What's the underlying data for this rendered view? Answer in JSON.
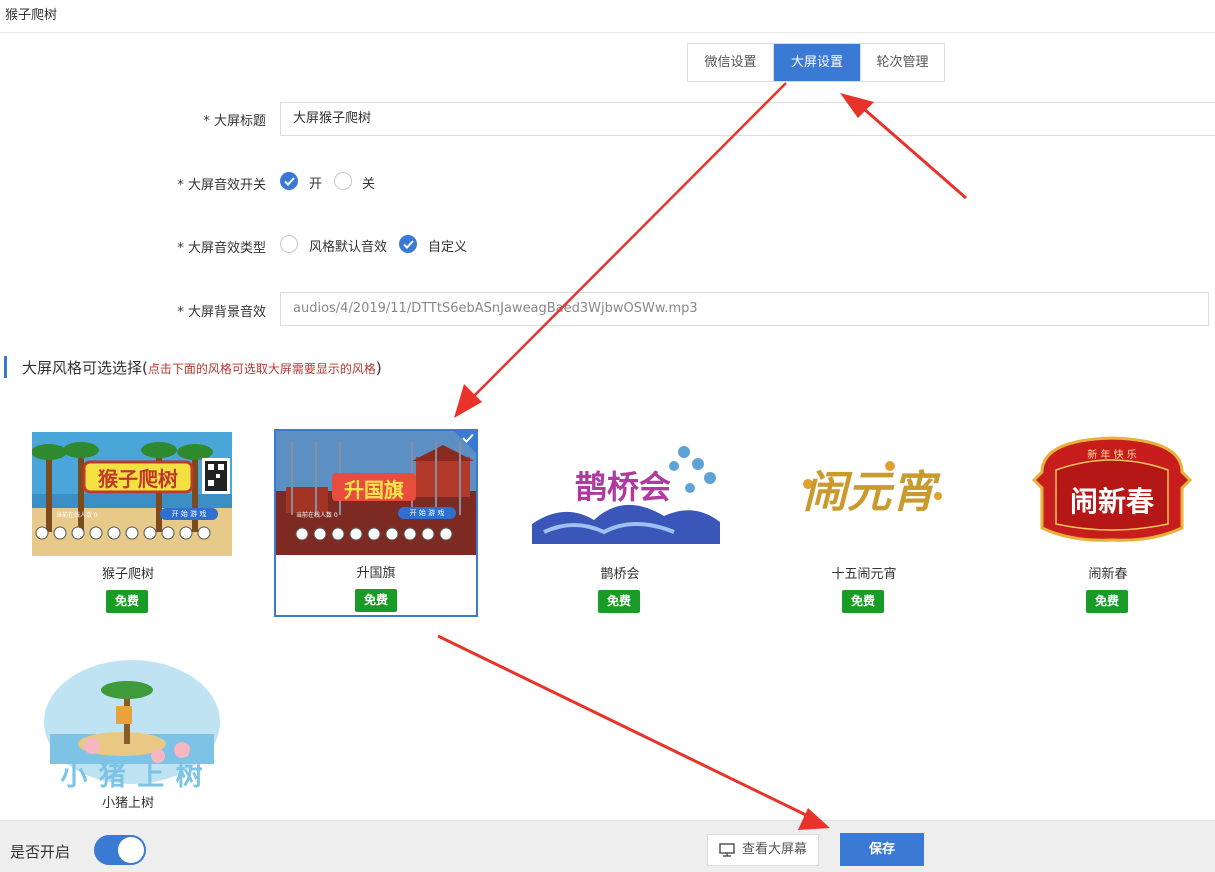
{
  "window": {
    "title": "猴子爬树"
  },
  "tabs": [
    {
      "label": "微信设置",
      "active": false
    },
    {
      "label": "大屏设置",
      "active": true
    },
    {
      "label": "轮次管理",
      "active": false
    }
  ],
  "form": {
    "screen_title": {
      "label": "* 大屏标题",
      "value": "大屏猴子爬树"
    },
    "sound_switch": {
      "label": "* 大屏音效开关",
      "on_label": "开",
      "off_label": "关",
      "selected": "开"
    },
    "sound_type": {
      "label": "* 大屏音效类型",
      "default_label": "风格默认音效",
      "custom_label": "自定义",
      "selected": "自定义"
    },
    "bg_sound": {
      "label": "* 大屏背景音效",
      "value": "audios/4/2019/11/DTTtS6ebASnJaweagBaed3WjbwOSWw.mp3"
    }
  },
  "styles_section": {
    "title": "大屏风格可选选择(",
    "hint": "点击下面的风格可选取大屏需要显示的风格",
    "title_end": ")"
  },
  "styles": [
    {
      "name": "猴子爬树",
      "badge": "免费",
      "selected": false
    },
    {
      "name": "升国旗",
      "badge": "免费",
      "selected": true
    },
    {
      "name": "鹊桥会",
      "badge": "免费",
      "selected": false
    },
    {
      "name": "十五闹元宵",
      "badge": "免费",
      "selected": false
    },
    {
      "name": "闹新春",
      "badge": "免费",
      "selected": false
    },
    {
      "name": "小猪上树",
      "badge": "免费",
      "selected": false
    }
  ],
  "thumb_text": {
    "monkey_title": "猴子爬树",
    "monkey_start": "开 始 游 戏",
    "monkey_count": "当前在线人数 0",
    "flag_title": "升国旗",
    "flag_start": "开 始 游 戏",
    "flag_count": "当前在线人数 0",
    "bridge_title": "鹊桥会",
    "lantern_title": "闹元宵",
    "spring_title": "闹新春",
    "spring_top": "新 年 快 乐",
    "pig_title": "小 猪 上 树"
  },
  "footer": {
    "enable_label": "是否开启",
    "enabled": true,
    "preview_label": "查看大屏幕",
    "save_label": "保存"
  },
  "colors": {
    "accent": "#3a79d4",
    "badge": "#1a9a26",
    "hint": "#b03a2e",
    "arrow": "#e8332a"
  }
}
